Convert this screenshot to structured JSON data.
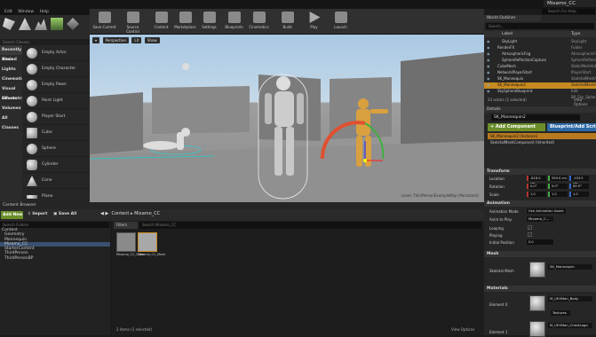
{
  "window": {
    "menus": [
      "Edit",
      "Window",
      "Help"
    ],
    "tab_title": "Mixamo_CC",
    "search_help": "Search For Help"
  },
  "modes": {
    "title": "Basic Classes",
    "search_placeholder": "Search Classes"
  },
  "place": {
    "categories": [
      "Recently Placed",
      "Basic",
      "Lights",
      "Cinematic",
      "Visual Effects",
      "Geometry",
      "Volumes",
      "All Classes"
    ],
    "items": [
      "Empty Actor",
      "Empty Character",
      "Empty Pawn",
      "Point Light",
      "Player Start",
      "Cube",
      "Sphere",
      "Cylinder",
      "Cone",
      "Plane"
    ]
  },
  "toolbar": {
    "buttons": [
      "Save Current",
      "Source Control",
      "Content",
      "Marketplace",
      "Settings",
      "Blueprints",
      "Cinematics",
      "Build",
      "Play",
      "Launch"
    ]
  },
  "viewport": {
    "buttons": [
      "Perspective",
      "Lit",
      "Show"
    ],
    "level_label": "Level: ThirdPersonExampleMap (Persistent)"
  },
  "content_browser": {
    "header": "Content Browser",
    "add_new": "Add New",
    "import": "Import",
    "save_all": "Save All",
    "breadcrumb": [
      "Content",
      "Mixamo_CC"
    ],
    "tree_search": "Search Folders",
    "tree": [
      "Content",
      "Geometry",
      "Mannequin",
      "Mixamo_CC",
      "StarterContent",
      "ThirdPerson",
      "ThirdPersonBP"
    ],
    "tree_selected_index": 3,
    "filters": "Filters",
    "asset_search": "Search Mixamo_CC",
    "assets": [
      {
        "name": "Mixamo_CC_Cube"
      },
      {
        "name": "Mixamo_CC_Mesh"
      }
    ],
    "item_count": "2 items (1 selected)",
    "view_options": "View Options"
  },
  "outliner": {
    "header": "World Outliner",
    "search_placeholder": "Search...",
    "col_label": "Label",
    "col_type": "Type",
    "rows": [
      {
        "name": "SkyLight",
        "type": "SkyLight",
        "indent": 2
      },
      {
        "name": "RenderFX",
        "type": "Folder",
        "indent": 1
      },
      {
        "name": "AtmosphericFog",
        "type": "AtmosphericFog",
        "indent": 2
      },
      {
        "name": "SphereReflectionCapture",
        "type": "SphereReflectionCapture",
        "indent": 2
      },
      {
        "name": "CubeMesh",
        "type": "StaticMeshActor",
        "indent": 1
      },
      {
        "name": "NetworkPlayerStart",
        "type": "PlayerStart",
        "indent": 1
      },
      {
        "name": "SK_Mannequin",
        "type": "SkeletalMeshActor",
        "indent": 1
      },
      {
        "name": "SK_Mannequin2",
        "type": "SkeletalMeshActor",
        "indent": 1,
        "selected": true
      },
      {
        "name": "SkySphereBlueprint",
        "type": "Edit BP_Sky_Sphere",
        "indent": 1
      }
    ],
    "actor_count": "23 actors (1 selected)",
    "view_options": "View Options"
  },
  "details": {
    "header": "Details",
    "actor_name": "SK_Mannequin2",
    "add_component": "+ Add Component",
    "blueprint_script": "Blueprint/Add Script",
    "components": [
      "SK_Mannequin2 (Instance)",
      "SkeletalMeshComponent (Inherited)"
    ],
    "transform": {
      "title": "Transform",
      "location_label": "Location",
      "location": [
        "-818.0 cm",
        "590.0 cm",
        "-103.5 cm"
      ],
      "rotation_label": "Rotation",
      "rotation": [
        "0.0°",
        "0.0°",
        "89.9°"
      ],
      "scale_label": "Scale",
      "scale": [
        "1.0",
        "1.0",
        "1.0"
      ]
    },
    "animation": {
      "title": "Animation",
      "mode_label": "Animation Mode",
      "mode_value": "Use Animation Asset",
      "anim_label": "Anim to Play",
      "anim_value": "Mixamo_C...",
      "looping_label": "Looping",
      "playing_label": "Playing",
      "initpos_label": "Initial Position",
      "initpos_value": "0.0"
    },
    "mesh": {
      "title": "Mesh",
      "skeletal_label": "Skeletal Mesh",
      "skeletal_value": "SK_Mannequin"
    },
    "materials": {
      "title": "Materials",
      "element0_label": "Element 0",
      "element0_value": "M_UE4Man_Body",
      "element0_dd": "Textures",
      "element1_label": "Element 1",
      "element1_value": "M_UE4Man_ChestLogo"
    }
  }
}
